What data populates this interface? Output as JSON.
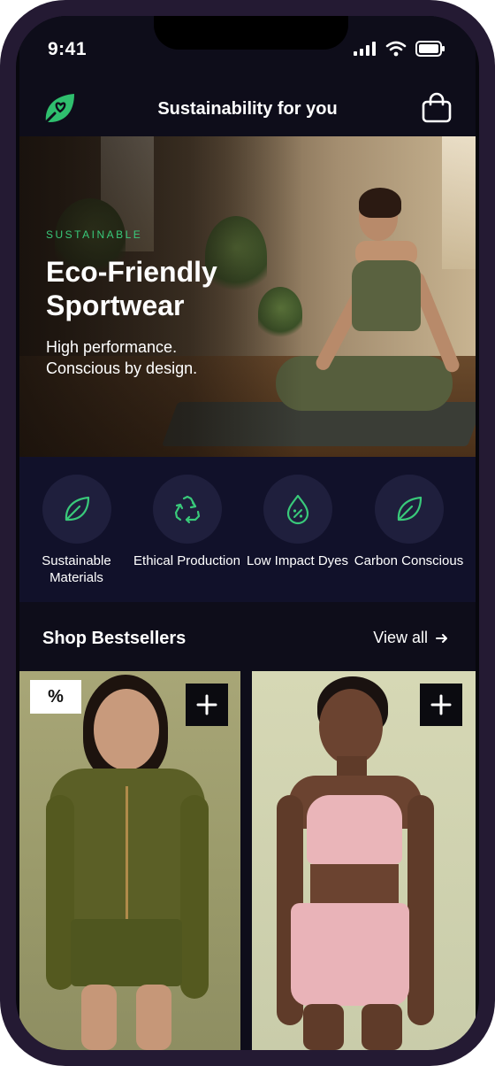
{
  "status": {
    "time": "9:41"
  },
  "header": {
    "title": "Sustainability for you",
    "logo_icon": "leaf-heart-icon",
    "bag_icon": "shopping-bag-icon"
  },
  "hero": {
    "eyebrow": "SUSTAINABLE",
    "title": "Eco-Friendly Sportwear",
    "subtitle": "High performance. Conscious by design."
  },
  "features": [
    {
      "icon": "leaf-icon",
      "label": "Sustainable Materials"
    },
    {
      "icon": "recycle-icon",
      "label": "Ethical Production"
    },
    {
      "icon": "drop-percent-icon",
      "label": "Low Impact Dyes"
    },
    {
      "icon": "leaf-icon",
      "label": "Carbon Conscious"
    }
  ],
  "bestsellers": {
    "title": "Shop Bestsellers",
    "view_all": "View all"
  },
  "products": [
    {
      "badge": "%",
      "add_label": "+"
    },
    {
      "add_label": "+"
    }
  ],
  "colors": {
    "accent": "#39c97a",
    "background": "#0e0d1a",
    "feature_band": "#11112a"
  }
}
